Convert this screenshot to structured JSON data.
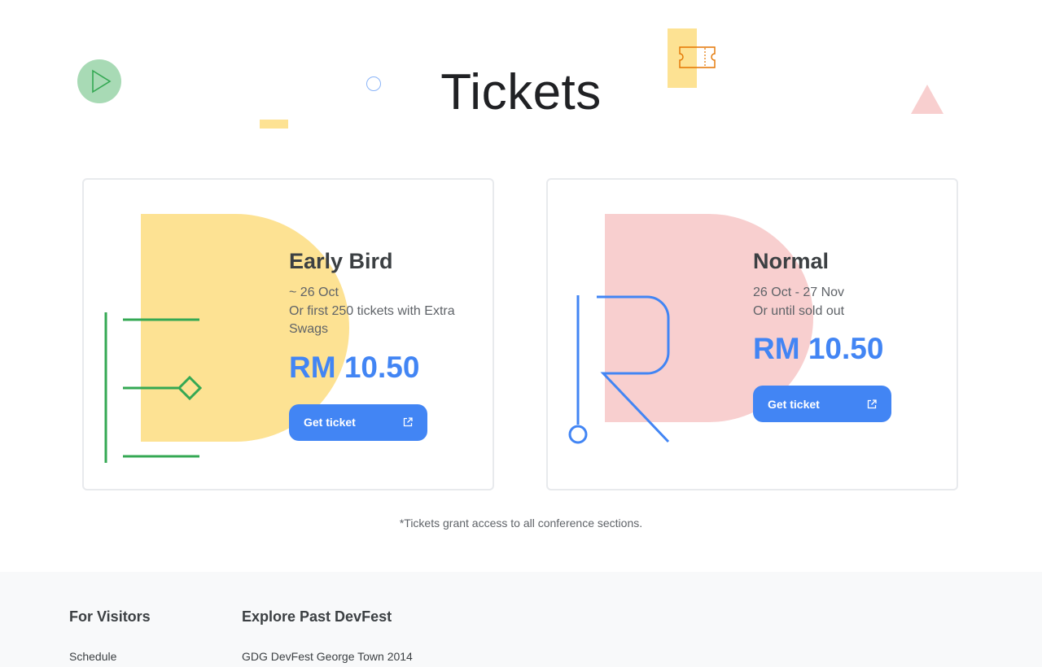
{
  "header": {
    "title": "Tickets"
  },
  "tickets": [
    {
      "name": "Early Bird",
      "dates": "~ 26 Oct",
      "condition": "Or first 250 tickets with Extra Swags",
      "price": "RM 10.50",
      "button_label": "Get ticket",
      "accent_color": "#fde293",
      "line_color": "#34a853"
    },
    {
      "name": "Normal",
      "dates": "26 Oct - 27 Nov",
      "condition": "Or until sold out",
      "price": "RM 10.50",
      "button_label": "Get ticket",
      "accent_color": "#f8cfcf",
      "line_color": "#4285f4"
    }
  ],
  "footnote": "*Tickets grant access to all conference sections.",
  "footer": {
    "columns": [
      {
        "heading": "For Visitors",
        "links": [
          "Schedule"
        ]
      },
      {
        "heading": "Explore Past DevFest",
        "links": [
          "GDG DevFest George Town 2014"
        ]
      }
    ]
  },
  "icons": {
    "play": "play-icon",
    "ticket": "ticket-icon",
    "external": "external-link-icon"
  },
  "colors": {
    "primary": "#4285f4",
    "title": "#202124",
    "muted": "#5f6368",
    "footer_bg": "#f8f9fa"
  }
}
